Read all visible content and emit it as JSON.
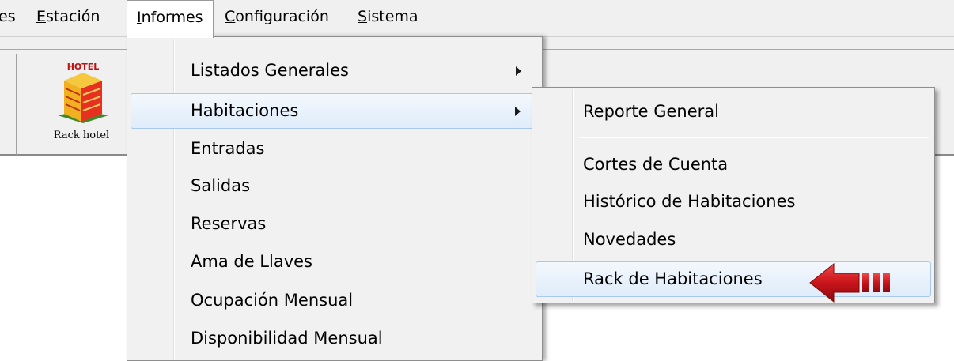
{
  "menubar": {
    "items": [
      {
        "label": "es",
        "mnemonic": ""
      },
      {
        "label_pre": "",
        "mnemonic": "E",
        "label_post": "stación"
      },
      {
        "label_pre": "",
        "mnemonic": "I",
        "label_post": "nformes"
      },
      {
        "label_pre": "",
        "mnemonic": "C",
        "label_post": "onfiguración"
      },
      {
        "label_pre": "",
        "mnemonic": "S",
        "label_post": "istema"
      }
    ]
  },
  "toolbar": {
    "rack_label": "Rack hotel",
    "logo_text": "HOTEL"
  },
  "informes_menu": {
    "items": [
      {
        "label": "Listados Generales",
        "submenu": true
      },
      {
        "label": "Habitaciones",
        "submenu": true
      },
      {
        "label": "Entradas"
      },
      {
        "label": "Salidas"
      },
      {
        "label": "Reservas"
      },
      {
        "label": "Ama de Llaves"
      },
      {
        "label": "Ocupación Mensual"
      },
      {
        "label": "Disponibilidad Mensual"
      }
    ]
  },
  "habitaciones_submenu": {
    "items": [
      {
        "label": "Reporte General"
      },
      {
        "label": "Cortes de Cuenta"
      },
      {
        "label": "Histórico de Habitaciones"
      },
      {
        "label": "Novedades"
      },
      {
        "label": "Rack de Habitaciones"
      }
    ]
  },
  "colors": {
    "menu_bg": "#f1f1f1",
    "highlight_border": "#a8c8ec",
    "arrow_red": "#c8141a"
  }
}
